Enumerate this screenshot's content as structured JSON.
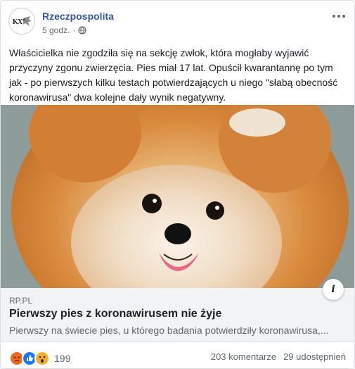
{
  "page": {
    "name": "Rzeczpospolita",
    "time": "5 godz.",
    "privacy_icon": "globe-icon"
  },
  "post": {
    "text": "Właścicielka nie zgodziła się na sekcję zwłok, która mogłaby wyjawić przyczyny zgonu zwierzęcia. Pies miał 17 lat. Opuścił kwarantannę po tym jak - po pierwszych kilku testach potwierdzających u niego \"słabą obecność koronawirusa\" dwa kolejne dały wynik negatywny."
  },
  "link": {
    "domain": "RP.PL",
    "title": "Pierwszy pies z koronawirusem nie żyje",
    "description": "Pierwszy na świecie pies, u którego badania potwierdziły koronawirusa,..."
  },
  "footer": {
    "reactions": [
      "angry",
      "like",
      "wow"
    ],
    "reaction_count": "199",
    "comments": "203 komentarze",
    "shares": "29 udostępnień"
  },
  "colors": {
    "page_name": "#385898",
    "secondary_text": "#606770",
    "like_blue": "#1877f2",
    "angry_orange": "#e9710f",
    "wow_yellow": "#f7b125"
  }
}
